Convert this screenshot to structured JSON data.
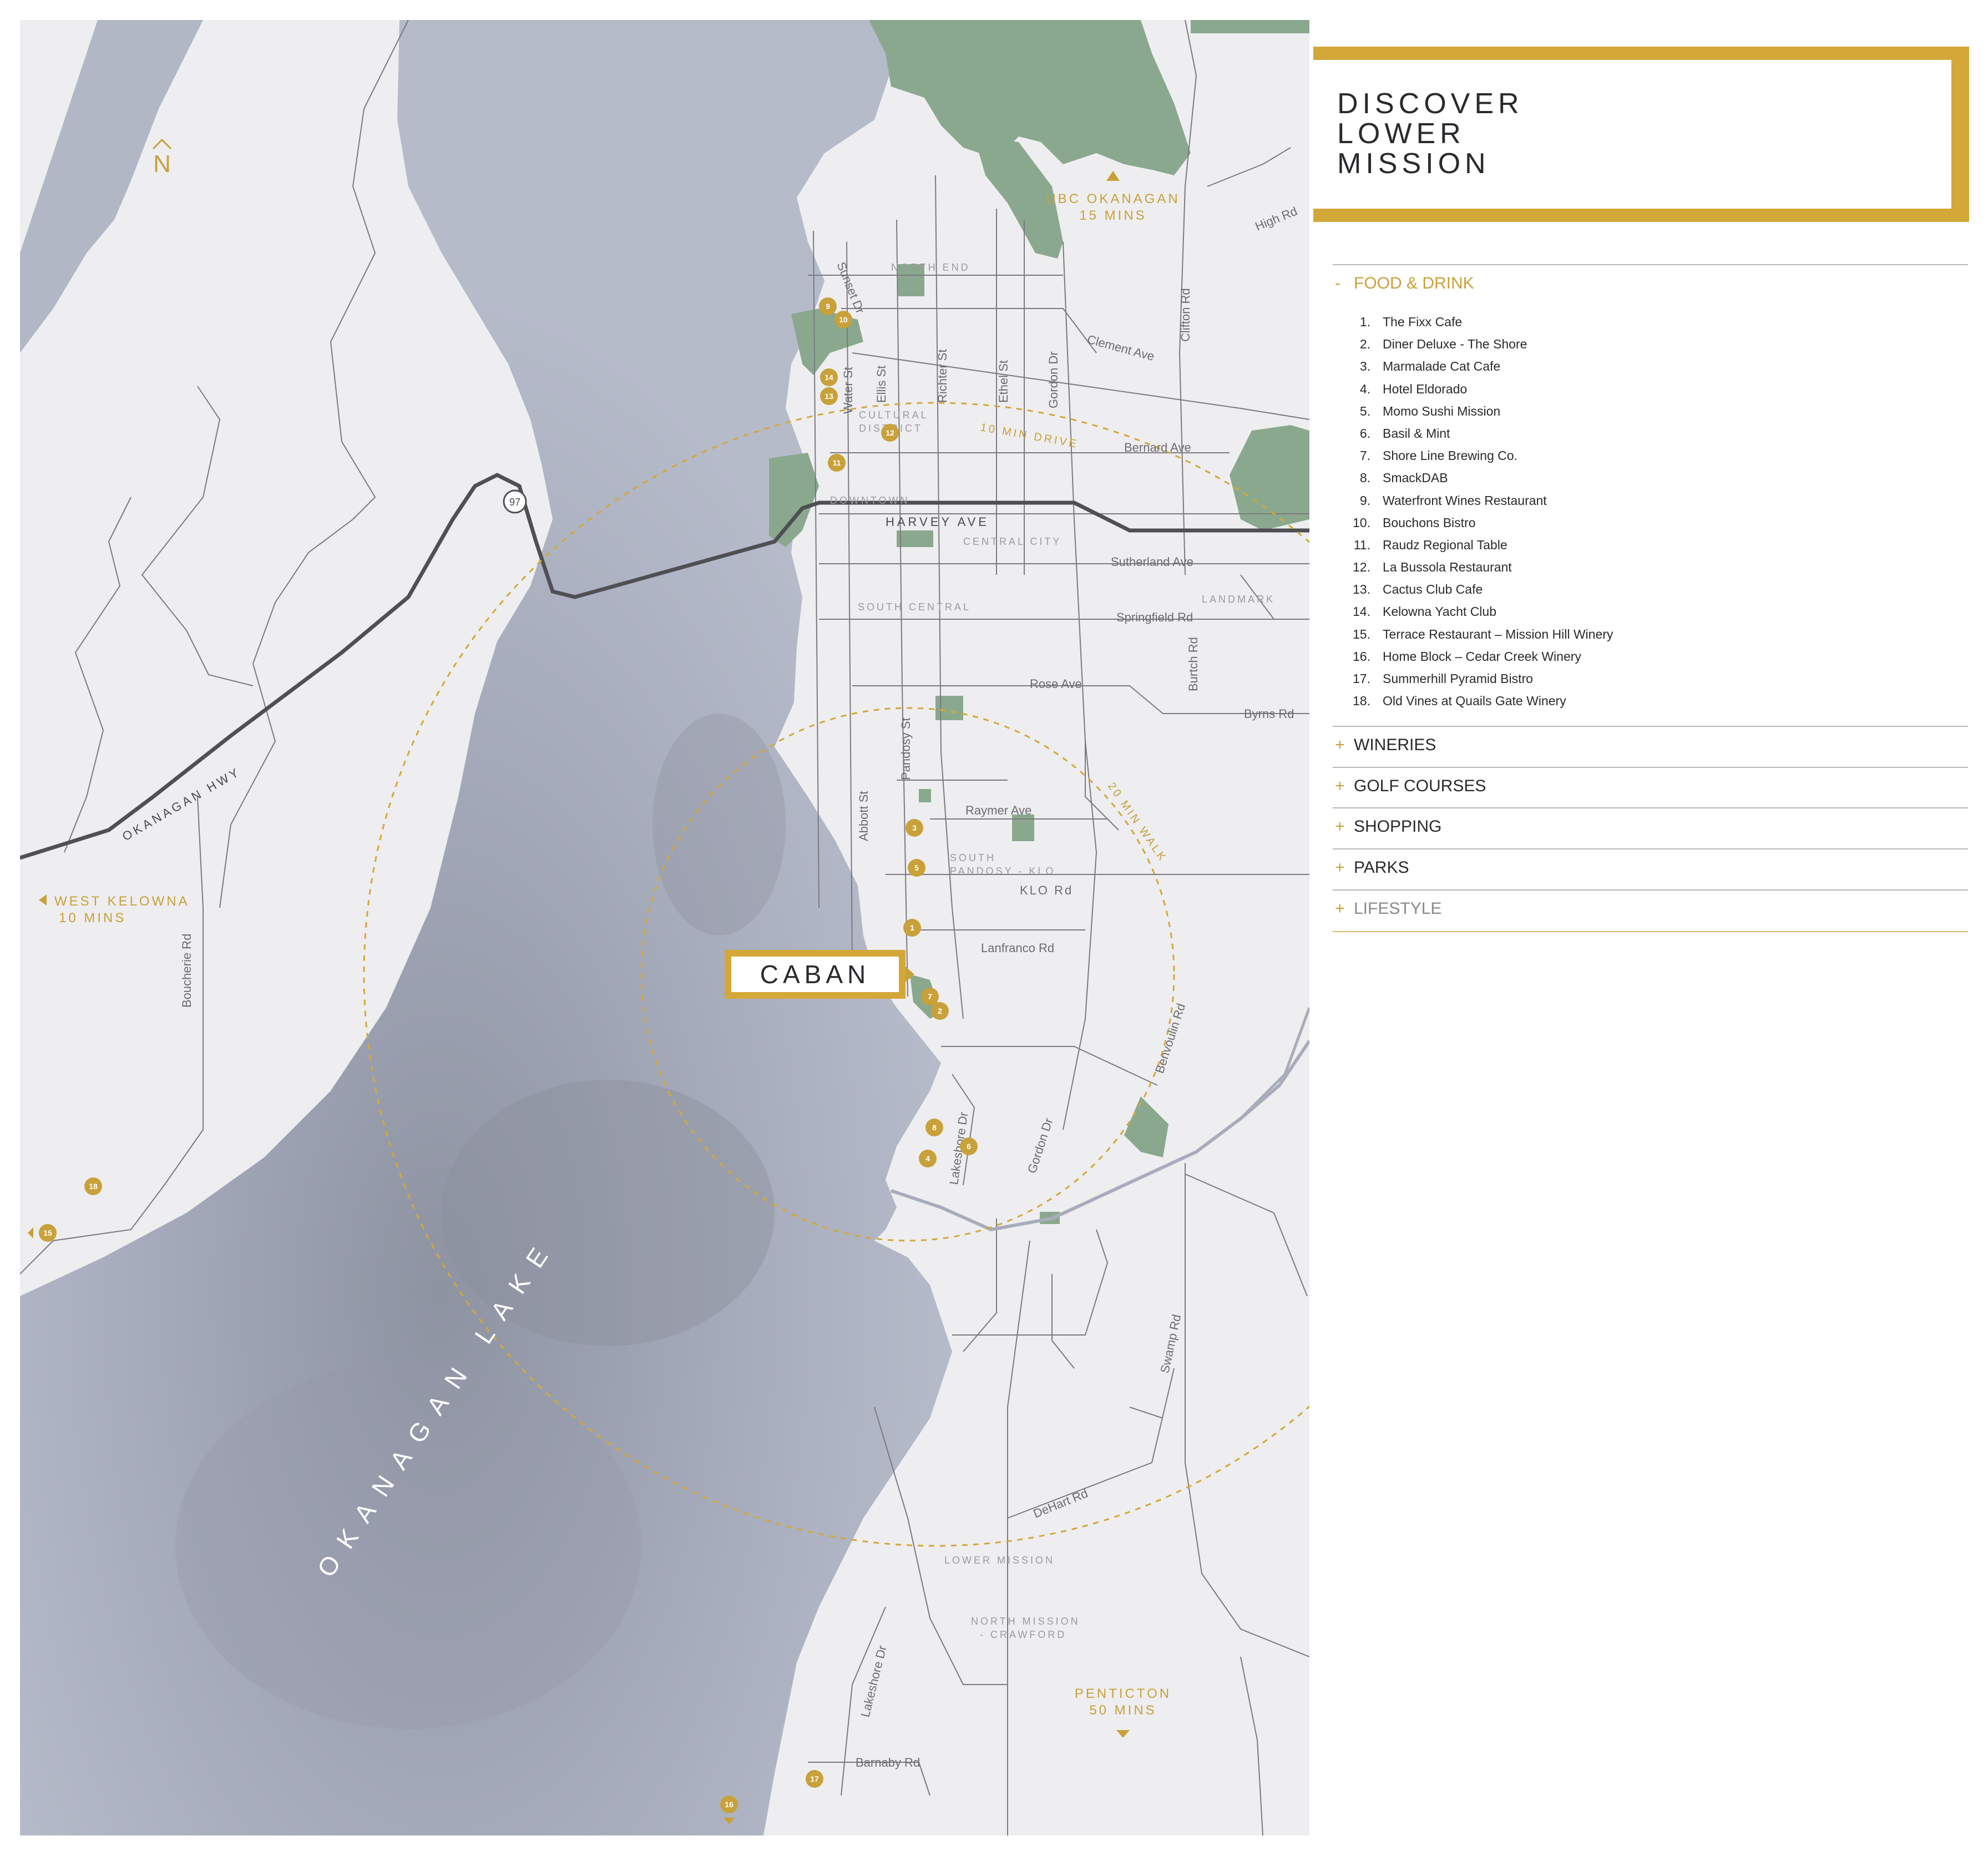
{
  "panel": {
    "title_lines": [
      "DISCOVER",
      "LOWER",
      "MISSION"
    ],
    "categories": [
      {
        "sign": "-",
        "label": "FOOD & DRINK",
        "state": "expanded"
      },
      {
        "sign": "+",
        "label": "WINERIES",
        "state": "collapsed"
      },
      {
        "sign": "+",
        "label": "GOLF COURSES",
        "state": "collapsed"
      },
      {
        "sign": "+",
        "label": "SHOPPING",
        "state": "collapsed"
      },
      {
        "sign": "+",
        "label": "PARKS",
        "state": "collapsed"
      },
      {
        "sign": "+",
        "label": "LIFESTYLE",
        "state": "muted"
      }
    ],
    "food_items": [
      {
        "n": "1.",
        "name": "The Fixx Cafe"
      },
      {
        "n": "2.",
        "name": "Diner Deluxe - The Shore"
      },
      {
        "n": "3.",
        "name": "Marmalade Cat Cafe"
      },
      {
        "n": "4.",
        "name": "Hotel Eldorado"
      },
      {
        "n": "5.",
        "name": "Momo Sushi Mission"
      },
      {
        "n": "6.",
        "name": "Basil & Mint"
      },
      {
        "n": "7.",
        "name": "Shore Line Brewing Co."
      },
      {
        "n": "8.",
        "name": "SmackDAB"
      },
      {
        "n": "9.",
        "name": "Waterfront Wines Restaurant"
      },
      {
        "n": "10.",
        "name": "Bouchons Bistro"
      },
      {
        "n": "11.",
        "name": "Raudz Regional Table"
      },
      {
        "n": "12.",
        "name": "La Bussola Restaurant"
      },
      {
        "n": "13.",
        "name": "Cactus Club Cafe"
      },
      {
        "n": "14.",
        "name": "Kelowna Yacht Club"
      },
      {
        "n": "15.",
        "name": "Terrace Restaurant – Mission Hill Winery"
      },
      {
        "n": "16.",
        "name": "Home Block – Cedar Creek Winery"
      },
      {
        "n": "17.",
        "name": "Summerhill Pyramid Bistro"
      },
      {
        "n": "18.",
        "name": "Old Vines at Quails Gate Winery"
      }
    ]
  },
  "map": {
    "caban_label": "CABAN",
    "north_label": "N",
    "lake_label": "OKANAGAN LAKE",
    "directions": {
      "ubc_1": "UBC OKANAGAN",
      "ubc_2": "15 MINS",
      "west_1": "WEST KELOWNA",
      "west_2": "10 MINS",
      "penticton_1": "PENTICTON",
      "penticton_2": "50 MINS"
    },
    "rings": {
      "drive": "10 MIN DRIVE",
      "walk": "20 MIN WALK"
    },
    "highway_labels": {
      "harvey": "HARVEY AVE",
      "okanagan": "OKANAGAN HWY",
      "shield": "97"
    },
    "districts": {
      "north_end": "NORTH END",
      "cultural_1": "CULTURAL",
      "cultural_2": "DISTRICT",
      "downtown": "DOWNTOWN",
      "central_city": "CENTRAL CITY",
      "south_central": "SOUTH CENTRAL",
      "landmark": "LANDMARK",
      "south_pandosy_1": "SOUTH",
      "south_pandosy_2": "PANDOSY - KLO",
      "lower_mission": "LOWER MISSION",
      "north_mission_1": "NORTH MISSION",
      "north_mission_2": "- CRAWFORD"
    },
    "streets": {
      "sunset": "Sunset Dr",
      "water": "Water St",
      "ellis": "Ellis St",
      "richter": "Richter St",
      "ethel": "Ethel St",
      "gordon_n": "Gordon Dr",
      "clifton": "Clifton Rd",
      "high": "High Rd",
      "clement": "Clement Ave",
      "bernard": "Bernard Ave",
      "sutherland": "Sutherland Ave",
      "springfield": "Springfield Rd",
      "burtch": "Burtch Rd",
      "rose": "Rose Ave",
      "byrns": "Byrns Rd",
      "abbott": "Abbott St",
      "pandosy": "Pandosy St",
      "raymer": "Raymer Ave",
      "klo": "KLO Rd",
      "lanfranco": "Lanfranco Rd",
      "benvoulin": "Benvoulin Rd",
      "lakeshore": "Lakeshore Dr",
      "gordon_s": "Gordon Dr",
      "boucherie": "Boucherie Rd",
      "swamp": "Swamp Rd",
      "dehart": "DeHart Rd",
      "lakeshore_s": "Lakeshore Dr",
      "barnaby": "Barnaby Rd"
    },
    "markers": [
      "1",
      "2",
      "3",
      "4",
      "5",
      "6",
      "7",
      "8",
      "9",
      "10",
      "11",
      "12",
      "13",
      "14",
      "15",
      "16",
      "17",
      "18"
    ],
    "colors": {
      "gold": "#c8a13a",
      "lake": "#a8adbd",
      "park": "#8aa88e",
      "land": "#eeeef0"
    }
  }
}
